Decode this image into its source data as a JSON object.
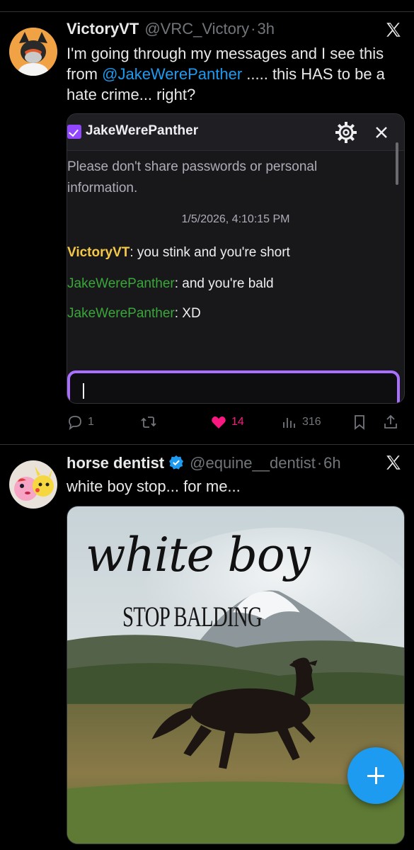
{
  "post1": {
    "author_name": "VictoryVT",
    "author_handle": "@VRC_Victory",
    "separator": "·",
    "time": "3h",
    "text_before_mention": "I'm going through my messages and I see this from ",
    "mention": "@JakeWerePanther",
    "text_after_mention": " ..... this HAS to be a hate crime... right?",
    "chat": {
      "title": "JakeWerePanther",
      "notice": "Please don't share passwords or personal information.",
      "timestamp": "1/5/2026, 4:10:15 PM",
      "messages": [
        {
          "user": "VictoryVT",
          "text": ": you stink and you're short"
        },
        {
          "user": "JakeWerePanther",
          "text": ": and you're bald"
        },
        {
          "user": "JakeWerePanther",
          "text": ": XD"
        }
      ]
    },
    "stats": {
      "replies": "1",
      "retweets": "",
      "likes": "14",
      "views": "316"
    }
  },
  "post2": {
    "author_name": "horse dentist",
    "author_handle": "@equine__dentist",
    "separator": "·",
    "time": "6h",
    "text": "white boy stop... for me...",
    "media": {
      "script_text": "white boy",
      "caption_text": "STOP BALDING"
    }
  },
  "colors": {
    "background": "#000000",
    "accent": "#1d9bf0",
    "like": "#f91880",
    "chat_accent": "#9147ff",
    "chat_user_victory": "#f5c84a",
    "chat_user_jake": "#3aa63a"
  },
  "icons": [
    "x-logo-icon",
    "verified-badge-icon",
    "gear-icon",
    "close-icon",
    "reply-icon",
    "retweet-icon",
    "heart-icon",
    "views-icon",
    "bookmark-icon",
    "share-icon",
    "plus-icon"
  ]
}
